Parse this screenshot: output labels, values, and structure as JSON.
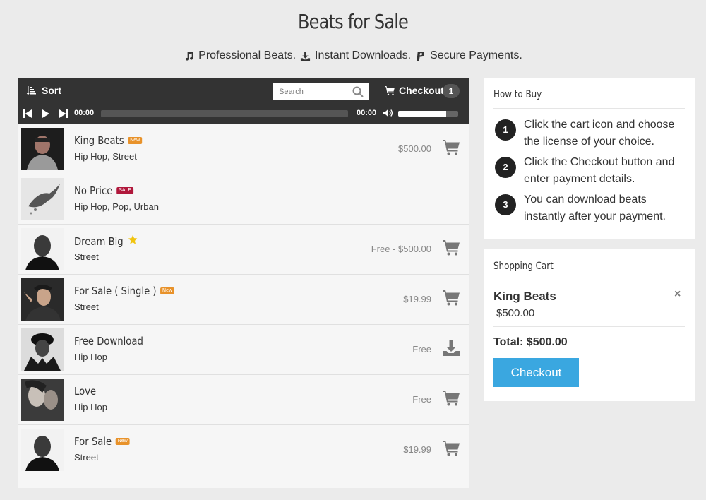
{
  "header": {
    "title": "Beats for Sale",
    "taglines": [
      {
        "icon": "music-note-icon",
        "text": "Professional Beats."
      },
      {
        "icon": "download-icon",
        "text": "Instant Downloads."
      },
      {
        "icon": "paypal-icon",
        "text": "Secure Payments."
      }
    ]
  },
  "toolbar": {
    "sort_label": "Sort",
    "search_placeholder": "Search",
    "checkout_label": "Checkout",
    "cart_count": "1"
  },
  "player": {
    "current_time": "00:00",
    "duration": "00:00",
    "progress": 0,
    "volume": 0.8
  },
  "tracks": [
    {
      "title": "King Beats",
      "tag": "New",
      "tag_type": "new",
      "genre": "Hip Hop, Street",
      "price": "$500.00",
      "action": "cart-icon"
    },
    {
      "title": "No Price",
      "tag": "SALE",
      "tag_type": "sale",
      "genre": "Hip Hop, Pop, Urban",
      "price": "",
      "action": ""
    },
    {
      "title": "Dream Big",
      "tag": "",
      "tag_type": "star",
      "genre": "Street",
      "price": "Free - $500.00",
      "action": "cart-icon"
    },
    {
      "title": "For Sale ( Single )",
      "tag": "New",
      "tag_type": "new",
      "genre": "Street",
      "price": "$19.99",
      "action": "cart-icon"
    },
    {
      "title": "Free Download",
      "tag": "",
      "tag_type": "",
      "genre": "Hip Hop",
      "price": "Free",
      "action": "download-icon"
    },
    {
      "title": "Love",
      "tag": "",
      "tag_type": "",
      "genre": "Hip Hop",
      "price": "Free",
      "action": "cart-icon"
    },
    {
      "title": "For Sale",
      "tag": "New",
      "tag_type": "new",
      "genre": "Street",
      "price": "$19.99",
      "action": "cart-icon"
    }
  ],
  "how_to_buy": {
    "title": "How to Buy",
    "steps": [
      {
        "num": "1",
        "text": "Click the cart icon and choose the license of your choice."
      },
      {
        "num": "2",
        "text": "Click the Checkout button and enter payment details."
      },
      {
        "num": "3",
        "text": "You can download beats instantly after your payment."
      }
    ]
  },
  "cart": {
    "title": "Shopping Cart",
    "item_name": "King Beats",
    "item_price": "$500.00",
    "remove": "×",
    "total": "Total: $500.00",
    "checkout_label": "Checkout"
  }
}
